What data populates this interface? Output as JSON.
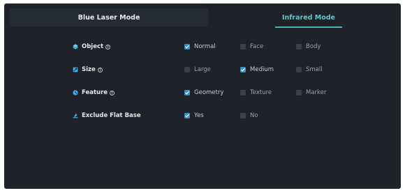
{
  "tabs": {
    "blue_laser": "Blue Laser Mode",
    "infrared": "Infrared Mode",
    "active": "infrared"
  },
  "colors": {
    "panel_bg": "#1f2329",
    "accent": "#5ec6cf",
    "checkbox_checked": "#3b8fc9",
    "checkbox_unchecked": "#3b414a"
  },
  "rows": [
    {
      "label": "Object",
      "icon": "cube-icon",
      "help": true,
      "options": [
        {
          "label": "Normal",
          "checked": true
        },
        {
          "label": "Face",
          "checked": false
        },
        {
          "label": "Body",
          "checked": false
        }
      ]
    },
    {
      "label": "Size",
      "icon": "size-icon",
      "help": true,
      "options": [
        {
          "label": "Large",
          "checked": false
        },
        {
          "label": "Medium",
          "checked": true
        },
        {
          "label": "Small",
          "checked": false
        }
      ]
    },
    {
      "label": "Feature",
      "icon": "feature-icon",
      "help": true,
      "options": [
        {
          "label": "Geometry",
          "checked": true
        },
        {
          "label": "Texture",
          "checked": false
        },
        {
          "label": "Marker",
          "checked": false
        }
      ]
    },
    {
      "label": "Exclude Flat Base",
      "icon": "flat-base-icon",
      "help": false,
      "options": [
        {
          "label": "Yes",
          "checked": true
        },
        {
          "label": "No",
          "checked": false
        }
      ]
    }
  ]
}
